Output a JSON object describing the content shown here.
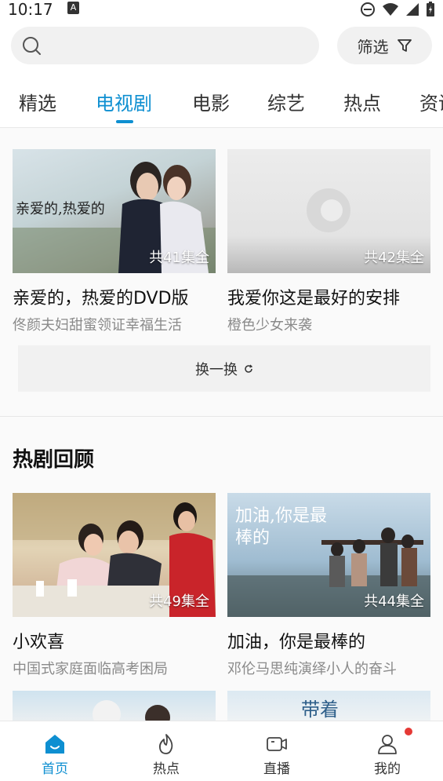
{
  "status": {
    "time": "10:17",
    "app_icon": "A"
  },
  "search": {
    "placeholder": ""
  },
  "filter": {
    "label": "筛选",
    "icon": "funnel-icon"
  },
  "tabs": [
    {
      "label": "精选"
    },
    {
      "label": "电视剧",
      "active": true
    },
    {
      "label": "电影"
    },
    {
      "label": "综艺"
    },
    {
      "label": "热点"
    },
    {
      "label": "资讯"
    }
  ],
  "featured": [
    {
      "title": "亲爱的，热爱的DVD版",
      "subtitle": "佟颜夫妇甜蜜领证幸福生活",
      "episodes": "共41集全",
      "poster_text": "亲爱的,热爱的"
    },
    {
      "title": "我爱你这是最好的安排",
      "subtitle": "橙色少女来袭",
      "episodes": "共42集全"
    }
  ],
  "refresh": {
    "label": "换一换"
  },
  "section": {
    "title": "热剧回顾"
  },
  "replay": [
    {
      "title": "小欢喜",
      "subtitle": "中国式家庭面临高考困局",
      "episodes": "共49集全"
    },
    {
      "title": "加油，你是最棒的",
      "subtitle": "邓伦马思纯演绎小人的奋斗",
      "episodes": "共44集全",
      "poster_text": "加油,你是最棒的"
    }
  ],
  "more_posters": [
    {
      "poster_text": ""
    },
    {
      "poster_text": "带着"
    }
  ],
  "bottom_nav": [
    {
      "label": "首页",
      "icon": "home-icon",
      "active": true
    },
    {
      "label": "热点",
      "icon": "flame-icon"
    },
    {
      "label": "直播",
      "icon": "camera-icon"
    },
    {
      "label": "我的",
      "icon": "person-icon",
      "badge": true
    }
  ],
  "colors": {
    "accent": "#0e8fd1",
    "badge": "#e53935"
  }
}
